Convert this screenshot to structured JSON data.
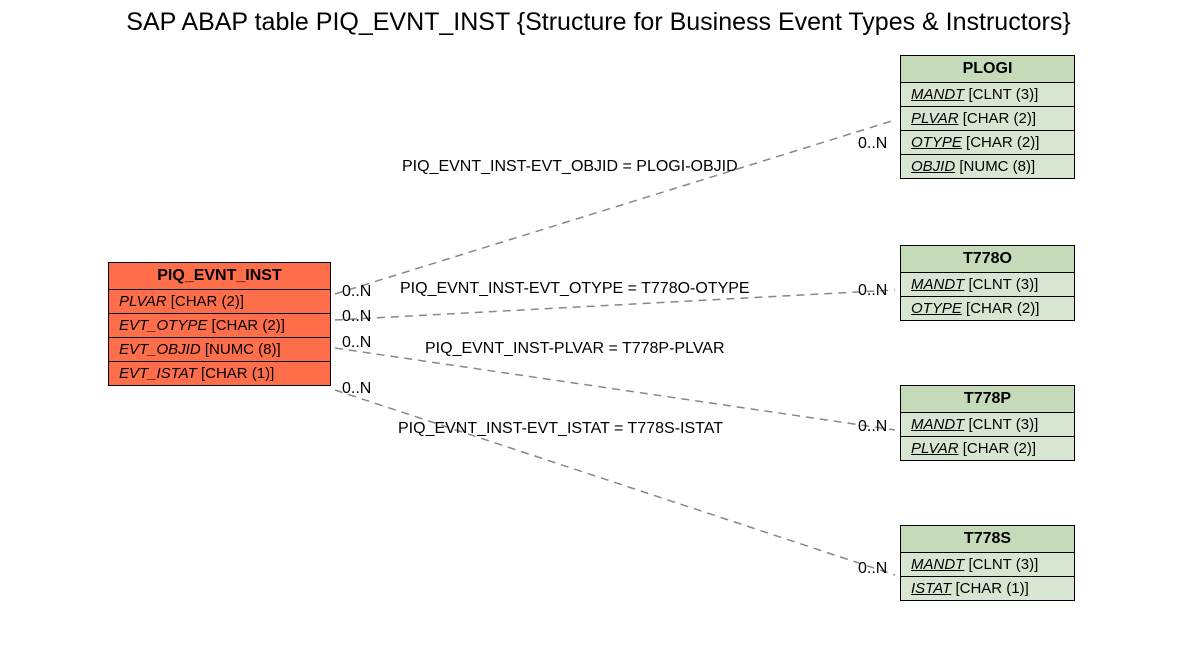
{
  "title": "SAP ABAP table PIQ_EVNT_INST {Structure for Business Event Types & Instructors}",
  "main": {
    "name": "PIQ_EVNT_INST",
    "fields": [
      {
        "name": "PLVAR",
        "type": "[CHAR (2)]"
      },
      {
        "name": "EVT_OTYPE",
        "type": "[CHAR (2)]"
      },
      {
        "name": "EVT_OBJID",
        "type": "[NUMC (8)]"
      },
      {
        "name": "EVT_ISTAT",
        "type": "[CHAR (1)]"
      }
    ]
  },
  "targets": {
    "plogi": {
      "name": "PLOGI",
      "fields": [
        {
          "name": "MANDT",
          "type": "[CLNT (3)]",
          "u": true
        },
        {
          "name": "PLVAR",
          "type": "[CHAR (2)]",
          "u": true
        },
        {
          "name": "OTYPE",
          "type": "[CHAR (2)]",
          "u": true
        },
        {
          "name": "OBJID",
          "type": "[NUMC (8)]",
          "u": true
        }
      ]
    },
    "t778o": {
      "name": "T778O",
      "fields": [
        {
          "name": "MANDT",
          "type": "[CLNT (3)]",
          "u": true
        },
        {
          "name": "OTYPE",
          "type": "[CHAR (2)]",
          "u": true
        }
      ]
    },
    "t778p": {
      "name": "T778P",
      "fields": [
        {
          "name": "MANDT",
          "type": "[CLNT (3)]",
          "u": true
        },
        {
          "name": "PLVAR",
          "type": "[CHAR (2)]",
          "u": true
        }
      ]
    },
    "t778s": {
      "name": "T778S",
      "fields": [
        {
          "name": "MANDT",
          "type": "[CLNT (3)]",
          "u": true
        },
        {
          "name": "ISTAT",
          "type": "[CHAR (1)]",
          "u": true
        }
      ]
    }
  },
  "relations": {
    "r1": {
      "label": "PIQ_EVNT_INST-EVT_OBJID = PLOGI-OBJID",
      "left_card": "0..N",
      "right_card": "0..N"
    },
    "r2": {
      "label": "PIQ_EVNT_INST-EVT_OTYPE = T778O-OTYPE",
      "left_card": "0..N",
      "right_card": "0..N"
    },
    "r3": {
      "label": "PIQ_EVNT_INST-PLVAR = T778P-PLVAR",
      "left_card": "0..N",
      "right_card": "0..N"
    },
    "r4": {
      "label": "PIQ_EVNT_INST-EVT_ISTAT = T778S-ISTAT",
      "left_card": "0..N",
      "right_card": "0..N"
    }
  }
}
